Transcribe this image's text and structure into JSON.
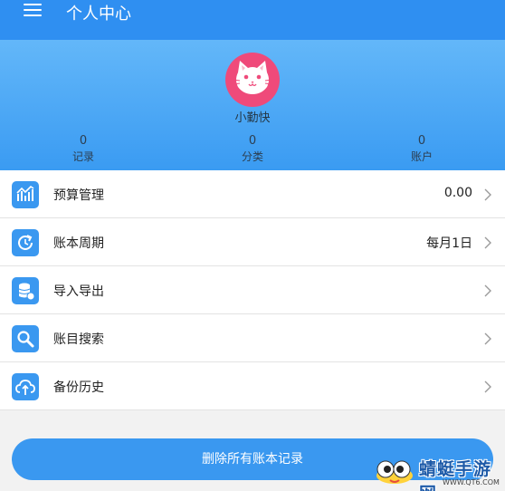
{
  "header": {
    "title": "个人中心",
    "menu_icon": "hamburger-menu-icon"
  },
  "profile": {
    "name": "小勤快",
    "avatar_icon": "cat-avatar-icon",
    "avatar_color": "#ef4a7a",
    "stats": [
      {
        "value": "0",
        "label": "记录"
      },
      {
        "value": "0",
        "label": "分类"
      },
      {
        "value": "0",
        "label": "账户"
      }
    ]
  },
  "menu": [
    {
      "label": "预算管理",
      "value": "0.00",
      "icon": "budget-chart-icon"
    },
    {
      "label": "账本周期",
      "value": "每月1日",
      "icon": "cycle-icon"
    },
    {
      "label": "导入导出",
      "value": "",
      "icon": "database-icon"
    },
    {
      "label": "账目搜索",
      "value": "",
      "icon": "search-icon"
    },
    {
      "label": "备份历史",
      "value": "",
      "icon": "cloud-upload-icon"
    }
  ],
  "actions": {
    "delete_all": "删除所有账本记录"
  },
  "watermark": {
    "text": "蜻蜓手游网",
    "url": "WWW.QT6.COM"
  },
  "colors": {
    "primary": "#3a98f0",
    "appbar": "#2f8ff1",
    "accent": "#ef4a7a"
  }
}
